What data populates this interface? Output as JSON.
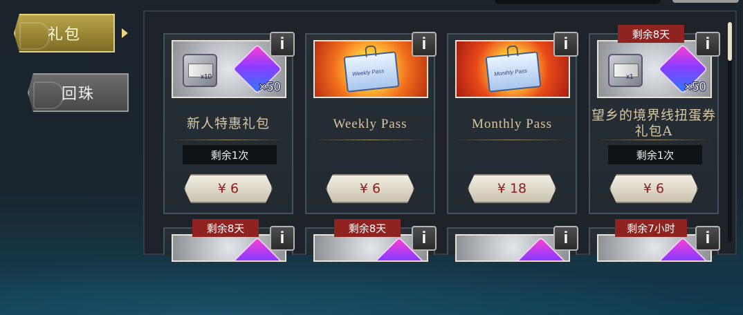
{
  "sidebar": {
    "tabs": [
      {
        "label": "礼包",
        "active": true
      },
      {
        "label": "回珠",
        "active": false
      }
    ]
  },
  "cards": [
    {
      "name": "新人特惠礼包",
      "limit": "剩余1次",
      "price": "¥ 6",
      "timer": null,
      "info": "i",
      "thumb": {
        "type": "items",
        "ticket_count": "x10",
        "gem_count": "×50"
      }
    },
    {
      "name": "Weekly Pass",
      "limit": null,
      "price": "¥ 6",
      "timer": null,
      "info": "i",
      "thumb": {
        "type": "pass",
        "pass_label": "Weekly Pass"
      }
    },
    {
      "name": "Monthly Pass",
      "limit": null,
      "price": "¥ 18",
      "timer": null,
      "info": "i",
      "thumb": {
        "type": "pass",
        "pass_label": "Monthly Pass"
      }
    },
    {
      "name": "望乡的境界线扭蛋券礼包A",
      "limit": "剩余1次",
      "price": "¥ 6",
      "timer": "剩余8天",
      "info": "i",
      "thumb": {
        "type": "items",
        "ticket_count": "x1",
        "gem_count": "×50"
      }
    }
  ],
  "row2_cards": [
    {
      "timer": "剩余8天",
      "info": "i"
    },
    {
      "timer": "剩余8天",
      "info": "i"
    },
    {
      "timer": null,
      "info": "i"
    },
    {
      "timer": "剩余7小时",
      "info": "i"
    }
  ],
  "colors": {
    "accent_gold": "#b9a64a",
    "timer_red": "#8f2320",
    "price_red": "#8a1d1d"
  }
}
